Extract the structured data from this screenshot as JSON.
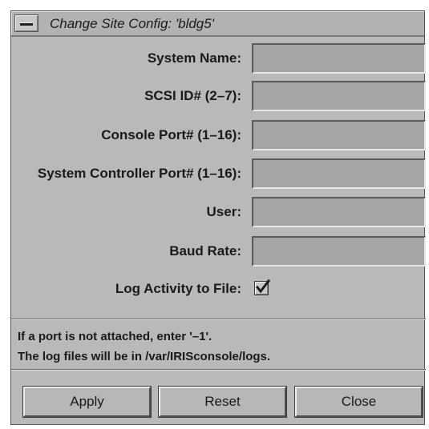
{
  "window": {
    "title": "Change Site Config: 'bldg5'"
  },
  "form": {
    "fields": [
      {
        "label": "System Name:",
        "value": ""
      },
      {
        "label": "SCSI ID# (2–7):",
        "value": ""
      },
      {
        "label": "Console Port# (1–16):",
        "value": ""
      },
      {
        "label": "System Controller Port# (1–16):",
        "value": ""
      },
      {
        "label": "User:",
        "value": ""
      },
      {
        "label": "Baud Rate:",
        "value": ""
      }
    ],
    "log_activity": {
      "label": "Log Activity to File:",
      "checked": true
    }
  },
  "info": {
    "line1": "If a port is not attached, enter '–1'.",
    "line2": "The log files will be in /var/IRISconsole/logs."
  },
  "buttons": {
    "apply": "Apply",
    "reset": "Reset",
    "close": "Close"
  },
  "colors": {
    "window_bg": "#b9b9b9",
    "field_bg": "#a5a5a5"
  }
}
